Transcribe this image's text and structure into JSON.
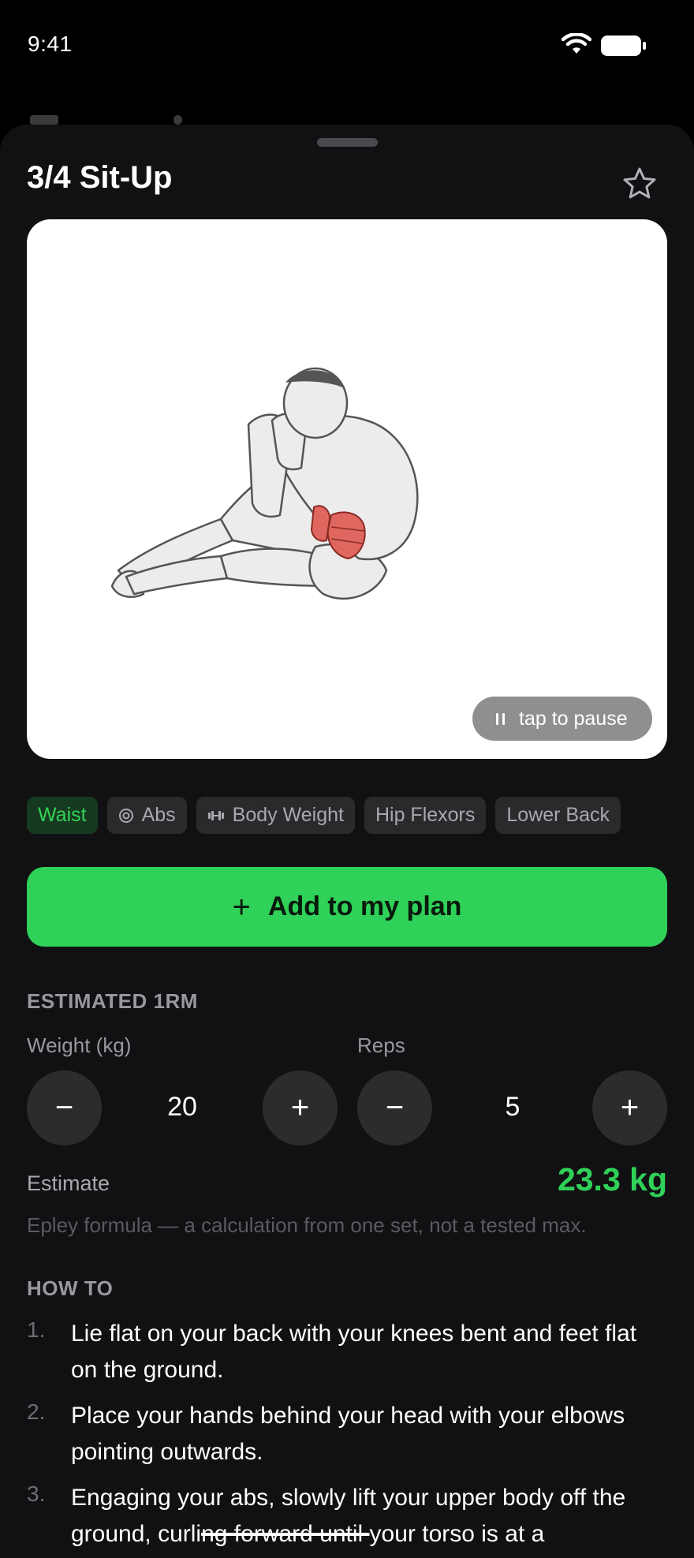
{
  "status_bar": {
    "time": "9:41"
  },
  "exercise": {
    "title": "3/4 Sit-Up",
    "media": {
      "pause_label": "tap to pause"
    },
    "chips": [
      {
        "label": "Waist",
        "icon": "",
        "active": true
      },
      {
        "label": "Abs",
        "icon": "target-icon",
        "active": false
      },
      {
        "label": "Body Weight",
        "icon": "dumbbell-icon",
        "active": false
      },
      {
        "label": "Hip Flexors",
        "icon": "",
        "active": false
      },
      {
        "label": "Lower Back",
        "icon": "",
        "active": false
      }
    ],
    "add_button_label": "Add to my plan"
  },
  "one_rm": {
    "heading": "ESTIMATED 1RM",
    "weight": {
      "label": "Weight (kg)",
      "value": "20"
    },
    "reps": {
      "label": "Reps",
      "value": "5"
    },
    "minus_symbol": "−",
    "plus_symbol": "+",
    "estimate_label": "Estimate",
    "estimate_value": "23.3 kg",
    "note": "Epley formula — a calculation from one set, not a tested max."
  },
  "how_to": {
    "heading": "HOW TO",
    "steps": [
      {
        "num": "1.",
        "text": "Lie flat on your back with your knees bent and feet flat on the ground."
      },
      {
        "num": "2.",
        "text": "Place your hands behind your head with your elbows pointing outwards."
      },
      {
        "num": "3.",
        "text_before": "Engaging your abs, slowly lift your upper body off the ground, curli",
        "text_struck": "ng forward until ",
        "text_after": "your torso is at a"
      }
    ]
  },
  "colors": {
    "accent": "#30d158",
    "sheet_bg": "#111113",
    "chip_bg": "#2a2a2d",
    "muted": "#98989d"
  }
}
